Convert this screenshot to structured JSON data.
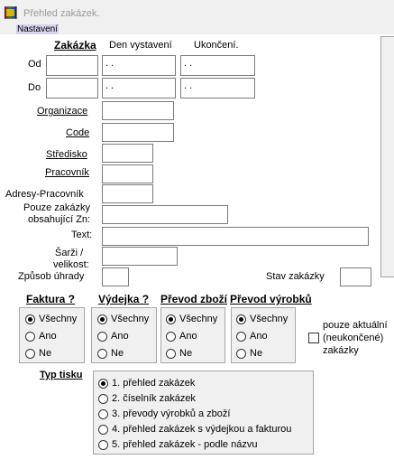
{
  "window": {
    "title": "Přehled zakázek."
  },
  "menu": {
    "settings_label": "Nastavení"
  },
  "headers": {
    "zakazka": "Zakázka",
    "den_vystaveni": "Den vystavení",
    "ukonceni": "Ukončení."
  },
  "rows": {
    "od_label": "Od",
    "do_label": "Do",
    "od_zakazka": "",
    "do_zakazka": "",
    "od_den": " .  .",
    "do_den": " .  .",
    "od_ukonceni": " .  .",
    "do_ukonceni": " .  ."
  },
  "fields": {
    "organizace_label": "Organizace",
    "organizace_value": "",
    "code_label": "Code",
    "code_value": "",
    "stredisko_label": "Středisko",
    "stredisko_value": "",
    "pracovnik_label": "Pracovník",
    "pracovnik_value": "",
    "adresy_label": "Adresy-Pracovník",
    "adresy_value": "",
    "pouze_label_1": "Pouze zakázky",
    "pouze_label_2": "obsahující Zn:",
    "pouze_value": "",
    "text_label": "Text:",
    "text_value": "",
    "sarzi_label_1": "Šarži /",
    "sarzi_label_2": "velikost:",
    "sarzi_value": "",
    "zpusob_label": "Způsob úhrady",
    "zpusob_value": "",
    "stav_label": "Stav zakázky",
    "stav_value": ""
  },
  "groups": {
    "faktura": {
      "title": "Faktura ?",
      "options": [
        "Všechny",
        "Ano",
        "Ne"
      ],
      "selected": "Všechny"
    },
    "vydejka": {
      "title": "Výdejka ?",
      "options": [
        "Všechny",
        "Ano",
        "Ne"
      ],
      "selected": "Všechny"
    },
    "prevod_zbozi": {
      "title": "Převod zboží",
      "options": [
        "Všechny",
        "Ano",
        "Ne"
      ],
      "selected": "Všechny"
    },
    "prevod_vyrobku": {
      "title": "Převod výrobků",
      "options": [
        "Všechny",
        "Ano",
        "Ne"
      ],
      "selected": "Všechny"
    }
  },
  "pouze_aktualni": {
    "line1": "pouze aktuální",
    "line2": "(neukončené)",
    "line3": "zakázky",
    "checked": false
  },
  "typ_tisku": {
    "title": "Typ tisku",
    "options": [
      "1. přehled zakázek",
      "2. číselník zakázek",
      "3. převody výrobků a zboží",
      "4. přehled zakázek s výdejkou a fakturou",
      "5. přehled zakázek - podle názvu"
    ],
    "selected": 0
  },
  "colors": {
    "window_bg": "#f0f0f0",
    "form_bg": "#ffffff",
    "menu_highlight": "#d9d3f0",
    "title_text": "#9a9a9a"
  }
}
